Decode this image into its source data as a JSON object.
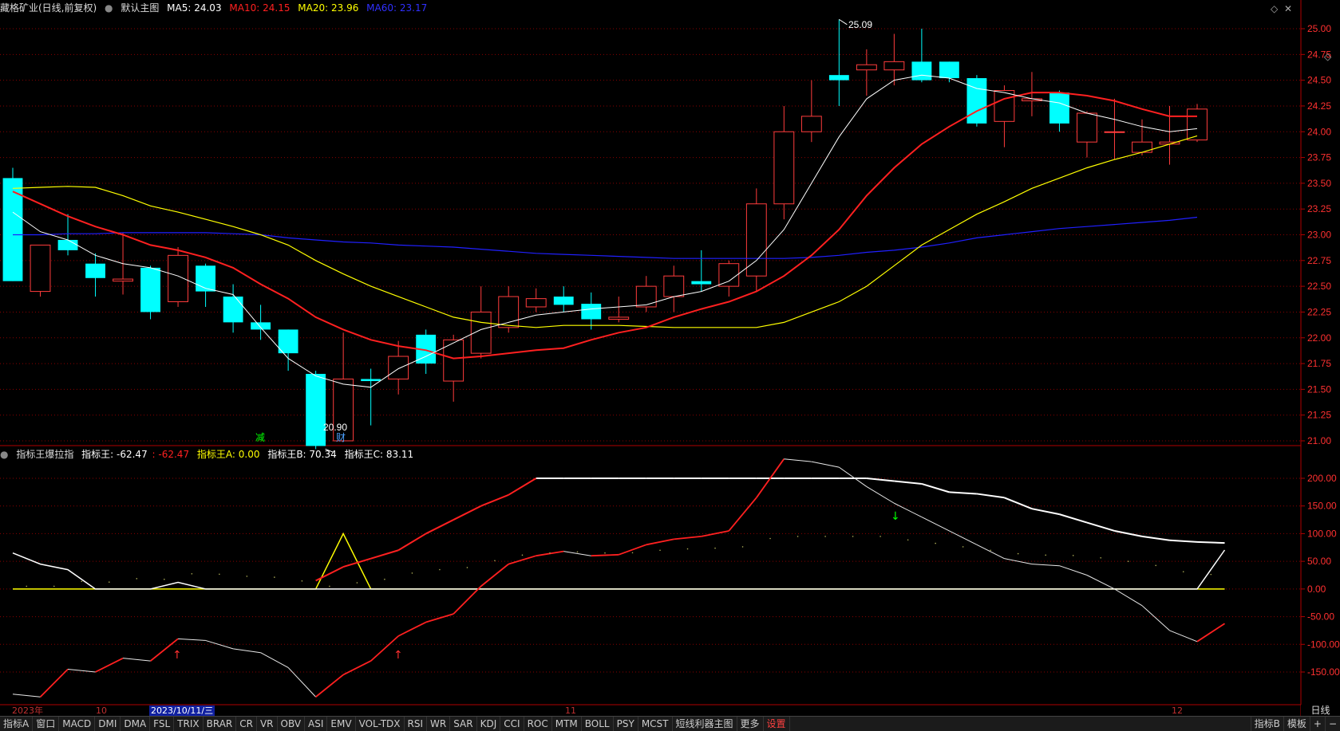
{
  "colors": {
    "up": "#ff3c3c",
    "down": "#00ffff",
    "ma5": "#ffffff",
    "ma10": "#ff2020",
    "ma20": "#ffff00",
    "ma60": "#2020ff",
    "grid": "#8a0000"
  },
  "main_header": {
    "stock": "藏格矿业(日线,前复权)",
    "template": "默认主图",
    "ma5": "MA5: 24.03",
    "ma10": "MA10: 24.15",
    "ma20": "MA20: 23.96",
    "ma60": "MA60: 23.17"
  },
  "ind_header": {
    "name": "指标王爆拉指",
    "main": "指标王: -62.47",
    "main_val": ": -62.47",
    "a": "指标王A: 0.00",
    "b": "指标王B: 70.34",
    "c": "指标王C: 83.11"
  },
  "markers": {
    "high": "25.09",
    "low": "20.90",
    "tag1": "减",
    "tag2": "财"
  },
  "dates": {
    "d1": "2023年",
    "d2": "10",
    "d3": "2023/10/11/三",
    "d4": "11",
    "d5": "12"
  },
  "period": "日线",
  "tabs": [
    "指标A",
    "窗口",
    "MACD",
    "DMI",
    "DMA",
    "FSL",
    "TRIX",
    "BRAR",
    "CR",
    "VR",
    "OBV",
    "ASI",
    "EMV",
    "VOL-TDX",
    "RSI",
    "WR",
    "SAR",
    "KDJ",
    "CCI",
    "ROC",
    "MTM",
    "BOLL",
    "PSY",
    "MCST",
    "短线利器主图",
    "更多",
    "设置"
  ],
  "right_tabs": [
    "指标B",
    "模板",
    "+",
    "−"
  ],
  "chart_data": [
    {
      "type": "candlestick",
      "y_ticks": [
        "25.00",
        "24.75",
        "24.50",
        "24.25",
        "24.00",
        "23.75",
        "23.50",
        "23.25",
        "23.00",
        "22.75",
        "22.50",
        "22.25",
        "22.00",
        "21.75",
        "21.50",
        "21.25",
        "21.00"
      ],
      "ylim": [
        20.8,
        25.15
      ],
      "candles": [
        [
          23.55,
          22.55,
          23.65,
          22.55
        ],
        [
          22.45,
          22.9,
          22.9,
          22.4
        ],
        [
          22.95,
          22.85,
          23.2,
          22.8
        ],
        [
          22.72,
          22.58,
          22.82,
          22.4
        ],
        [
          22.55,
          22.57,
          23.02,
          22.42
        ],
        [
          22.68,
          22.25,
          22.7,
          22.18
        ],
        [
          22.35,
          22.8,
          22.88,
          22.3
        ],
        [
          22.7,
          22.45,
          22.72,
          22.3
        ],
        [
          22.4,
          22.15,
          22.52,
          22.05
        ],
        [
          22.15,
          22.08,
          22.32,
          21.98
        ],
        [
          22.08,
          21.85,
          22.08,
          21.68
        ],
        [
          21.65,
          20.95,
          21.68,
          20.92
        ],
        [
          21.0,
          21.6,
          22.05,
          21.0
        ],
        [
          21.6,
          21.58,
          21.7,
          21.15
        ],
        [
          21.6,
          21.82,
          21.97,
          21.45
        ],
        [
          22.03,
          21.75,
          22.08,
          21.65
        ],
        [
          21.58,
          21.98,
          22.03,
          21.38
        ],
        [
          21.85,
          22.25,
          22.5,
          21.8
        ],
        [
          22.1,
          22.4,
          22.5,
          22.05
        ],
        [
          22.3,
          22.38,
          22.48,
          22.25
        ],
        [
          22.4,
          22.32,
          22.5,
          22.25
        ],
        [
          22.33,
          22.18,
          22.44,
          22.08
        ],
        [
          22.18,
          22.2,
          22.4,
          22.15
        ],
        [
          22.3,
          22.5,
          22.6,
          22.25
        ],
        [
          22.4,
          22.6,
          22.7,
          22.25
        ],
        [
          22.55,
          22.52,
          22.85,
          22.45
        ],
        [
          22.5,
          22.72,
          22.75,
          22.4
        ],
        [
          22.6,
          23.3,
          23.45,
          22.45
        ],
        [
          23.3,
          24.0,
          24.25,
          23.15
        ],
        [
          24.0,
          24.15,
          24.5,
          23.9
        ],
        [
          24.55,
          24.5,
          25.09,
          24.25
        ],
        [
          24.6,
          24.65,
          24.8,
          24.35
        ],
        [
          24.6,
          24.68,
          24.95,
          24.45
        ],
        [
          24.68,
          24.5,
          25.0,
          24.48
        ],
        [
          24.68,
          24.52,
          24.68,
          24.48
        ],
        [
          24.52,
          24.08,
          24.55,
          24.05
        ],
        [
          24.1,
          24.4,
          24.45,
          23.85
        ],
        [
          24.3,
          24.32,
          24.58,
          24.15
        ],
        [
          24.38,
          24.08,
          24.4,
          24.0
        ],
        [
          23.9,
          24.18,
          24.2,
          23.75
        ],
        [
          24.0,
          24.0,
          24.32,
          23.73
        ],
        [
          23.8,
          23.9,
          24.12,
          23.77
        ],
        [
          23.88,
          23.9,
          24.25,
          23.68
        ],
        [
          23.92,
          24.22,
          24.27,
          23.9
        ]
      ],
      "ma5": [
        23.22,
        23.03,
        22.95,
        22.8,
        22.72,
        22.68,
        22.6,
        22.48,
        22.42,
        22.1,
        21.8,
        21.63,
        21.55,
        21.52,
        21.7,
        21.82,
        21.95,
        22.08,
        22.15,
        22.22,
        22.25,
        22.28,
        22.3,
        22.32,
        22.4,
        22.45,
        22.55,
        22.75,
        23.05,
        23.5,
        23.95,
        24.32,
        24.5,
        24.55,
        24.52,
        24.42,
        24.38,
        24.32,
        24.28,
        24.18,
        24.12,
        24.05,
        24.0,
        24.03
      ],
      "ma10": [
        23.42,
        23.3,
        23.18,
        23.08,
        23.0,
        22.9,
        22.85,
        22.78,
        22.68,
        22.52,
        22.38,
        22.2,
        22.08,
        21.98,
        21.92,
        21.88,
        21.8,
        21.82,
        21.85,
        21.88,
        21.9,
        21.98,
        22.05,
        22.1,
        22.2,
        22.28,
        22.35,
        22.45,
        22.6,
        22.8,
        23.05,
        23.38,
        23.65,
        23.88,
        24.05,
        24.2,
        24.32,
        24.38,
        24.38,
        24.35,
        24.3,
        24.22,
        24.15,
        24.15
      ],
      "ma20": [
        23.45,
        23.46,
        23.47,
        23.46,
        23.38,
        23.28,
        23.22,
        23.15,
        23.08,
        23.0,
        22.9,
        22.75,
        22.62,
        22.5,
        22.4,
        22.3,
        22.2,
        22.15,
        22.12,
        22.1,
        22.12,
        22.12,
        22.12,
        22.11,
        22.1,
        22.1,
        22.1,
        22.1,
        22.15,
        22.25,
        22.35,
        22.5,
        22.7,
        22.9,
        23.05,
        23.2,
        23.32,
        23.45,
        23.55,
        23.65,
        23.73,
        23.8,
        23.88,
        23.96
      ],
      "ma60": [
        23.0,
        23.0,
        23.01,
        23.01,
        23.02,
        23.02,
        23.02,
        23.02,
        23.01,
        23.0,
        22.97,
        22.95,
        22.93,
        22.92,
        22.9,
        22.89,
        22.88,
        22.86,
        22.84,
        22.82,
        22.81,
        22.8,
        22.79,
        22.78,
        22.77,
        22.77,
        22.77,
        22.77,
        22.77,
        22.78,
        22.8,
        22.83,
        22.85,
        22.88,
        22.92,
        22.97,
        23.0,
        23.03,
        23.06,
        23.08,
        23.1,
        23.12,
        23.14,
        23.17
      ]
    },
    {
      "type": "line",
      "name": "指标王爆拉指",
      "y_ticks": [
        "200.00",
        "150.00",
        "100.00",
        "50.00",
        "0.00",
        "-50.00",
        "-100.00",
        "-150.00"
      ],
      "ylim": [
        -200,
        240
      ],
      "series": [
        {
          "name": "指标王",
          "color": "#ffffff",
          "values": [
            -190,
            -195,
            -145,
            -150,
            -125,
            -130,
            -90,
            -93,
            -108,
            -115,
            -142,
            -195,
            -155,
            -130,
            -85,
            -60,
            -45,
            5,
            45,
            60,
            68,
            60,
            62,
            80,
            90,
            95,
            105,
            165,
            235,
            230,
            220,
            185,
            155,
            130,
            105,
            80,
            55,
            45,
            42,
            25,
            0,
            -30,
            -75,
            -95,
            -62.47
          ]
        },
        {
          "name": "指标王A",
          "color": "#ffff00",
          "values": [
            0,
            0,
            0,
            0,
            0,
            0,
            0,
            0,
            0,
            0,
            0,
            0,
            100,
            0,
            0,
            0,
            0,
            0,
            0,
            0,
            0,
            0,
            0,
            0,
            0,
            0,
            0,
            0,
            0,
            0,
            0,
            0,
            0,
            0,
            0,
            0,
            0,
            0,
            0,
            0,
            0,
            0,
            0,
            0,
            0
          ]
        },
        {
          "name": "指标王B",
          "color": "#ffffff",
          "values": [
            65,
            45,
            35,
            0,
            0,
            0,
            12,
            0,
            0,
            0,
            0,
            0,
            0,
            0,
            0,
            0,
            0,
            0,
            0,
            0,
            0,
            0,
            0,
            0,
            0,
            0,
            0,
            0,
            0,
            0,
            0,
            0,
            0,
            0,
            0,
            0,
            0,
            0,
            0,
            0,
            0,
            0,
            0,
            0,
            70.34
          ]
        },
        {
          "name": "指标王C",
          "color": "#ffffff",
          "values": [
            null,
            null,
            null,
            null,
            null,
            null,
            null,
            null,
            null,
            null,
            null,
            15,
            40,
            55,
            70,
            100,
            125,
            150,
            170,
            200,
            200,
            200,
            200,
            200,
            200,
            200,
            200,
            200,
            200,
            200,
            200,
            200,
            195,
            190,
            175,
            172,
            165,
            145,
            135,
            120,
            105,
            95,
            88,
            85,
            83.11
          ]
        }
      ]
    }
  ]
}
